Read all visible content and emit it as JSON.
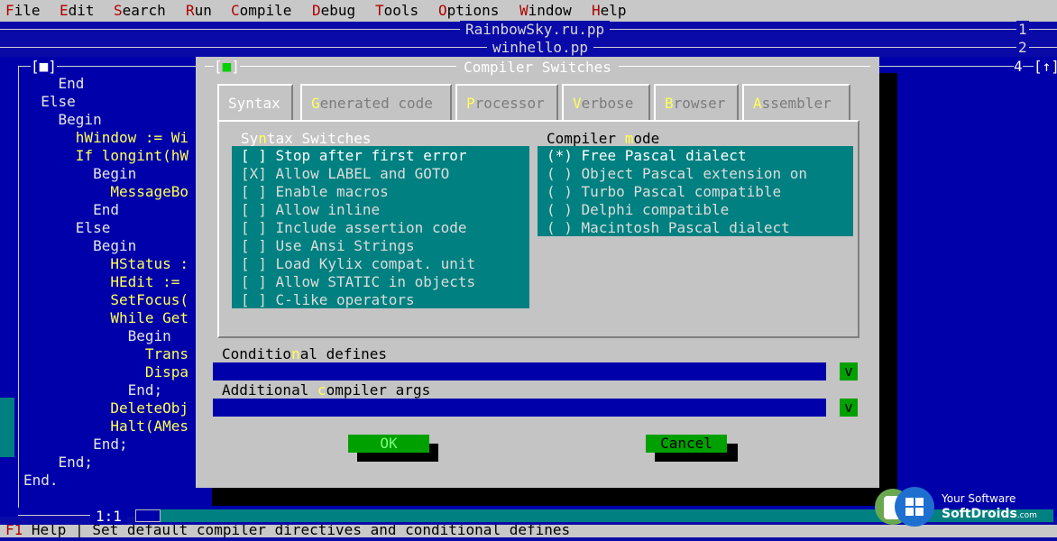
{
  "menu": {
    "items": [
      {
        "hk": "F",
        "rest": "ile"
      },
      {
        "hk": "E",
        "rest": "dit"
      },
      {
        "hk": "S",
        "rest": "earch"
      },
      {
        "hk": "R",
        "rest": "un"
      },
      {
        "hk": "C",
        "rest": "ompile"
      },
      {
        "hk": "D",
        "rest": "ebug"
      },
      {
        "hk": "T",
        "rest": "ools"
      },
      {
        "hk": "O",
        "rest": "ptions"
      },
      {
        "hk": "W",
        "rest": "indow"
      },
      {
        "hk": "H",
        "rest": "elp"
      }
    ]
  },
  "desktop": {
    "windows": [
      {
        "title": "RainbowSky.ru.pp",
        "number": "1"
      },
      {
        "title": "winhello.pp",
        "number": "2"
      }
    ],
    "editor_number": "4",
    "close_box": "[■]",
    "zoom_box": "[↑]",
    "cursor_pos": "1:1"
  },
  "code": [
    "    End",
    "  Else",
    "    Begin",
    "      hWindow := Wi",
    "      If longint(hW",
    "        Begin",
    "          MessageBo",
    "        End",
    "      Else",
    "        Begin",
    "          HStatus :",
    "          HEdit :=",
    "          SetFocus(",
    "          While Get",
    "            Begin",
    "              Trans",
    "              Dispa",
    "            End;",
    "          DeleteObj",
    "          Halt(AMes",
    "        End;",
    "    End;",
    "End."
  ],
  "dialog": {
    "title": "Compiler Switches",
    "close_box": "[■]",
    "tabs": [
      {
        "hk": "",
        "label": "Syntax"
      },
      {
        "hk": "G",
        "label": "enerated code"
      },
      {
        "hk": "P",
        "label": "rocessor"
      },
      {
        "hk": "V",
        "label": "erbose"
      },
      {
        "hk": "B",
        "label": "rowser"
      },
      {
        "hk": "A",
        "label": "ssembler"
      }
    ],
    "syntax_group": {
      "pre": "Sy",
      "hk": "n",
      "post": "tax Switches"
    },
    "syntax_switches": [
      {
        "box": "[ ]",
        "label": "Stop after first error"
      },
      {
        "box": "[X]",
        "label": "Allow LABEL and GOTO"
      },
      {
        "box": "[ ]",
        "label": "Enable macros"
      },
      {
        "box": "[ ]",
        "label": "Allow inline"
      },
      {
        "box": "[ ]",
        "label": "Include assertion code"
      },
      {
        "box": "[ ]",
        "label": "Use Ansi Strings"
      },
      {
        "box": "[ ]",
        "label": "Load Kylix compat. unit"
      },
      {
        "box": "[ ]",
        "label": "Allow STATIC in objects"
      },
      {
        "box": "[ ]",
        "label": "C-like operators"
      }
    ],
    "mode_group": {
      "pre": "Compiler ",
      "hk": "m",
      "post": "ode"
    },
    "compiler_modes": [
      {
        "radio": "(*)",
        "label": "Free Pascal dialect"
      },
      {
        "radio": "( )",
        "label": "Object Pascal extension on"
      },
      {
        "radio": "( )",
        "label": "Turbo Pascal compatible"
      },
      {
        "radio": "( )",
        "label": "Delphi compatible"
      },
      {
        "radio": "( )",
        "label": "Macintosh Pascal dialect"
      }
    ],
    "conditional": {
      "pre": "Conditio",
      "hk": "n",
      "post": "al defines",
      "value": ""
    },
    "additional": {
      "pre": "Additional ",
      "hk": "c",
      "post": "ompiler args",
      "value": ""
    },
    "dropdown_glyph": "v",
    "ok_label": "OK",
    "cancel_label": "Cancel"
  },
  "status": {
    "key": "F1",
    "text": " Help | Set default compiler directives and conditional defines"
  },
  "watermark": {
    "line1": "Your Software",
    "line2": "SoftDroids",
    "suffix": ".com"
  },
  "colors": {
    "desktop_blue": "#0000aa",
    "dialog_gray": "#c4c4c4",
    "panel_teal": "#008080",
    "button_green": "#00a000",
    "hotkey_yellow": "#ffff55"
  }
}
